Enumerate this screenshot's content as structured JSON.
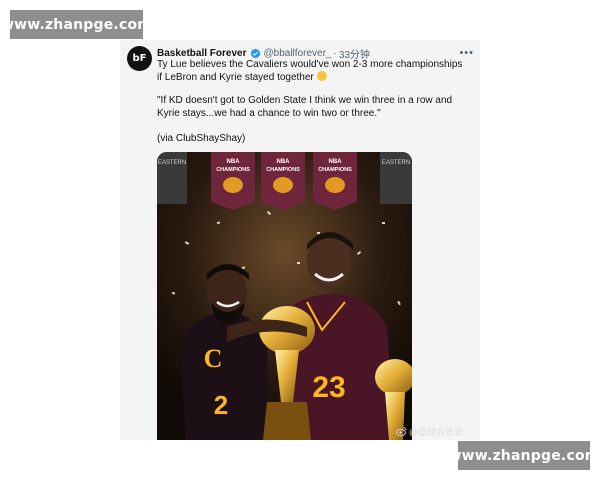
{
  "watermarks": {
    "top": "www.zhanpge.com",
    "bottom": "www.zhanpge.com"
  },
  "tweet": {
    "avatar_text": "bF",
    "author_name": "Basketball Forever",
    "handle": "@bballforever_",
    "separator": "·",
    "time": "33分钟",
    "more_icon": "more-horizontal-icon",
    "text_line1": "Ty Lue believes the Cavaliers would've won 2-3 more championships if LeBron and Kyrie stayed together",
    "text_quote": "\"If KD doesn't got to Golden State I think we win three in a row and Kyrie stays...we had a chance to win two or three.\"",
    "text_via": "(via ClubShayShay)"
  },
  "media": {
    "banner_line1": "NBA",
    "banner_line2": "CHAMPIONS",
    "banner_left_top": "EASTERN",
    "banner_right_top": "EASTERN",
    "jersey_left": "2",
    "jersey_right": "23",
    "team_mark": "C",
    "weibo_watermark": "@篮球名言说"
  },
  "colors": {
    "wine": "#6f263d",
    "gold": "#ffb81c",
    "navy": "#041e42",
    "verified": "#1d9bf0"
  }
}
